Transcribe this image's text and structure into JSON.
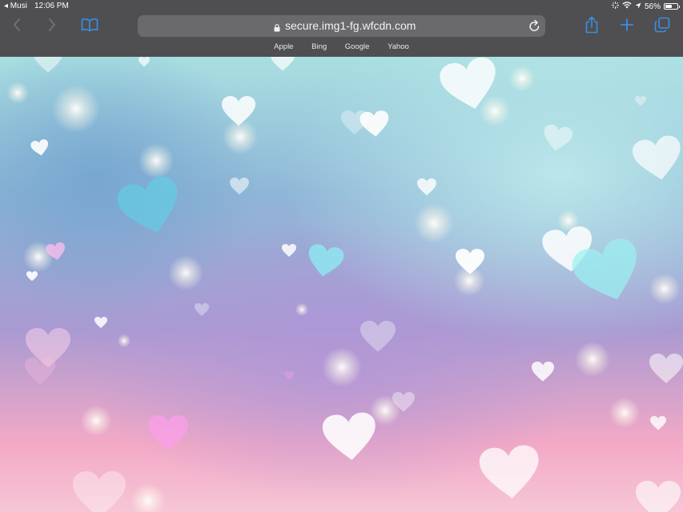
{
  "status_bar": {
    "back_app": "◂ Musi",
    "time": "12:06 PM",
    "battery_percent": "56%",
    "battery_level": 0.56
  },
  "toolbar": {
    "url": "secure.img1-fg.wfcdn.com",
    "icons": [
      "back-icon",
      "forward-icon",
      "bookmarks-icon",
      "lock-icon",
      "reload-icon",
      "share-icon",
      "add-tab-icon",
      "tabs-icon"
    ]
  },
  "favorites": [
    "Apple",
    "Bing",
    "Google",
    "Yahoo"
  ],
  "colors": {
    "chrome": "#4f4f51",
    "address_bar": "#6a6a6d",
    "accent": "#3a8ee6",
    "sky_teal": "#a9dfe1",
    "sky_blue": "#8fb6d7",
    "lavender": "#a99ad2",
    "pink": "#f3a9c6"
  }
}
